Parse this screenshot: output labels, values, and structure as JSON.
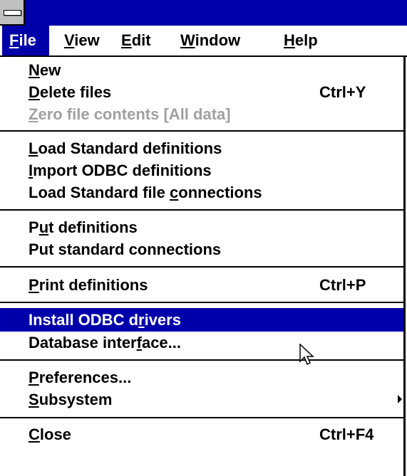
{
  "menubar": {
    "items": [
      {
        "mnemonic": "F",
        "rest": "ile"
      },
      {
        "mnemonic": "V",
        "rest": "iew"
      },
      {
        "mnemonic": "E",
        "rest": "dit"
      },
      {
        "mnemonic": "W",
        "rest": "indow"
      },
      {
        "mnemonic": "H",
        "rest": "elp"
      }
    ]
  },
  "file_menu": {
    "items": [
      {
        "pre": "",
        "u": "N",
        "post": "ew",
        "shortcut": ""
      },
      {
        "pre": "",
        "u": "D",
        "post": "elete files",
        "shortcut": "Ctrl+Y"
      },
      {
        "pre": "",
        "u": "Z",
        "post": "ero file contents [All data]",
        "shortcut": ""
      },
      {
        "pre": "",
        "u": "L",
        "post": "oad Standard definitions",
        "shortcut": ""
      },
      {
        "pre": "",
        "u": "I",
        "post": "mport ODBC definitions",
        "shortcut": ""
      },
      {
        "pre": "Load Standard file ",
        "u": "c",
        "post": "onnections",
        "shortcut": ""
      },
      {
        "pre": "P",
        "u": "u",
        "post": "t definitions",
        "shortcut": ""
      },
      {
        "pre": "Put standard connections",
        "u": "",
        "post": "",
        "shortcut": ""
      },
      {
        "pre": "",
        "u": "P",
        "post": "rint definitions",
        "shortcut": "Ctrl+P"
      },
      {
        "pre": "Install ODBC d",
        "u": "r",
        "post": "ivers",
        "shortcut": ""
      },
      {
        "pre": "Database inter",
        "u": "f",
        "post": "ace...",
        "shortcut": ""
      },
      {
        "pre": "",
        "u": "P",
        "post": "references...",
        "shortcut": ""
      },
      {
        "pre": "",
        "u": "S",
        "post": "ubsystem",
        "shortcut": ""
      },
      {
        "pre": "",
        "u": "C",
        "post": "lose",
        "shortcut": "Ctrl+F4"
      }
    ]
  },
  "colors": {
    "titlebar": "#0000aa",
    "highlight": "#0000aa",
    "disabled_text": "#a0a0a0"
  }
}
